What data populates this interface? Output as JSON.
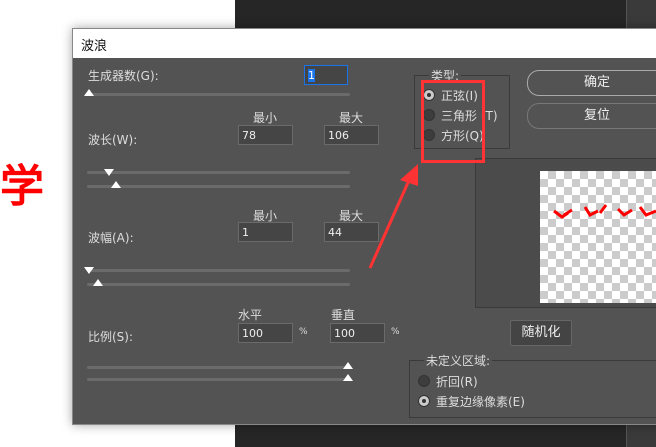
{
  "background": {
    "text": "学",
    "accent": "#ff0000"
  },
  "dialog": {
    "title": "波浪",
    "generators": {
      "label": "生成器数(G):",
      "value": "1"
    },
    "wavelength": {
      "label": "波长(W):",
      "min_label": "最小",
      "max_label": "最大",
      "min": "78",
      "max": "106"
    },
    "amplitude": {
      "label": "波幅(A):",
      "min_label": "最小",
      "max_label": "最大",
      "min": "1",
      "max": "44"
    },
    "scale": {
      "label": "比例(S):",
      "h_label": "水平",
      "v_label": "垂直",
      "h": "100",
      "v": "100",
      "unit": "%"
    },
    "type": {
      "legend": "类型:",
      "options": [
        {
          "label": "正弦(I)",
          "checked": true
        },
        {
          "label": "三角形 (T)",
          "checked": false
        },
        {
          "label": "方形(Q)",
          "checked": false
        }
      ]
    },
    "ok_label": "确定",
    "reset_label": "复位",
    "randomize_label": "随机化",
    "undefined_area": {
      "legend": "未定义区域:",
      "options": [
        {
          "label": "折回(R)",
          "checked": false
        },
        {
          "label": "重复边缘像素(E)",
          "checked": true
        }
      ]
    }
  }
}
